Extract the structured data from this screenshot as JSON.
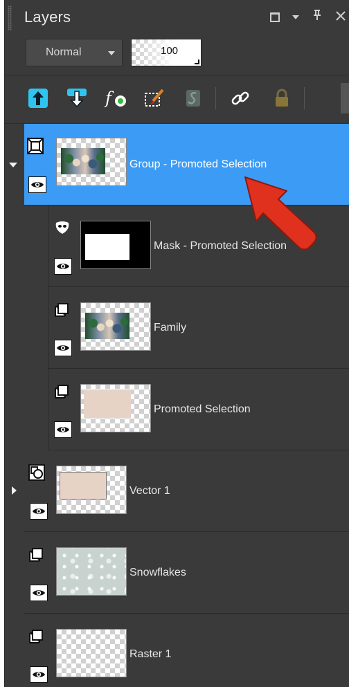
{
  "panel": {
    "title": "Layers",
    "blend_mode": "Normal",
    "opacity": "100"
  },
  "window_controls": [
    "maximize-icon",
    "dropdown-icon",
    "pin-icon",
    "close-icon"
  ],
  "toolbar": {
    "icons": [
      "move-layer-up-icon",
      "move-layer-down-icon",
      "layer-effects-icon",
      "brush-icon",
      "script-icon",
      "link-icon",
      "lock-icon"
    ]
  },
  "layers": [
    {
      "label": "Group - Promoted Selection",
      "type": "group",
      "selected": true,
      "expanded": true,
      "visible": true
    },
    {
      "label": "Mask - Promoted Selection",
      "type": "mask",
      "parent": "group",
      "visible": true
    },
    {
      "label": "Family",
      "type": "raster",
      "parent": "group",
      "visible": true
    },
    {
      "label": "Promoted Selection",
      "type": "raster",
      "parent": "group",
      "visible": true
    },
    {
      "label": "Vector 1",
      "type": "vector",
      "expanded": false,
      "visible": true
    },
    {
      "label": "Snowflakes",
      "type": "raster",
      "visible": true
    },
    {
      "label": "Raster 1",
      "type": "raster",
      "visible": true
    }
  ],
  "colors": {
    "panel_bg": "#3a3a3a",
    "selected_row": "#3c9cf5",
    "arrow_annotation": "#e0301e"
  }
}
